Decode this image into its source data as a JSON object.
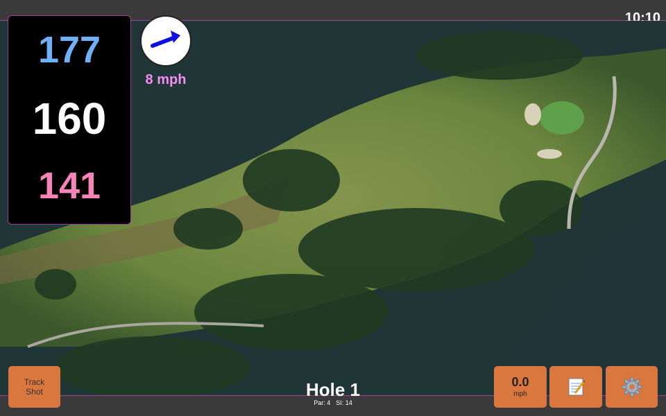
{
  "status": {
    "time": "10:10"
  },
  "distances": {
    "back": "177",
    "center": "160",
    "front": "141"
  },
  "wind": {
    "speed_label": "8 mph",
    "icon": "arrow-icon",
    "color": "#1010e0"
  },
  "track_shot": {
    "line1": "Track",
    "line2": "Shot"
  },
  "hole": {
    "title": "Hole 1",
    "par": "Par: 4",
    "si": "SI: 14"
  },
  "speed": {
    "value": "0.0",
    "unit": "mph"
  },
  "notes": {
    "icon": "notepad-icon"
  },
  "settings": {
    "icon": "gear-icon"
  },
  "colors": {
    "accent": "#d9773f",
    "border": "#9b3f9b",
    "back": "#6fb0f6",
    "front": "#f784b8",
    "wind_text": "#f48ef2"
  }
}
